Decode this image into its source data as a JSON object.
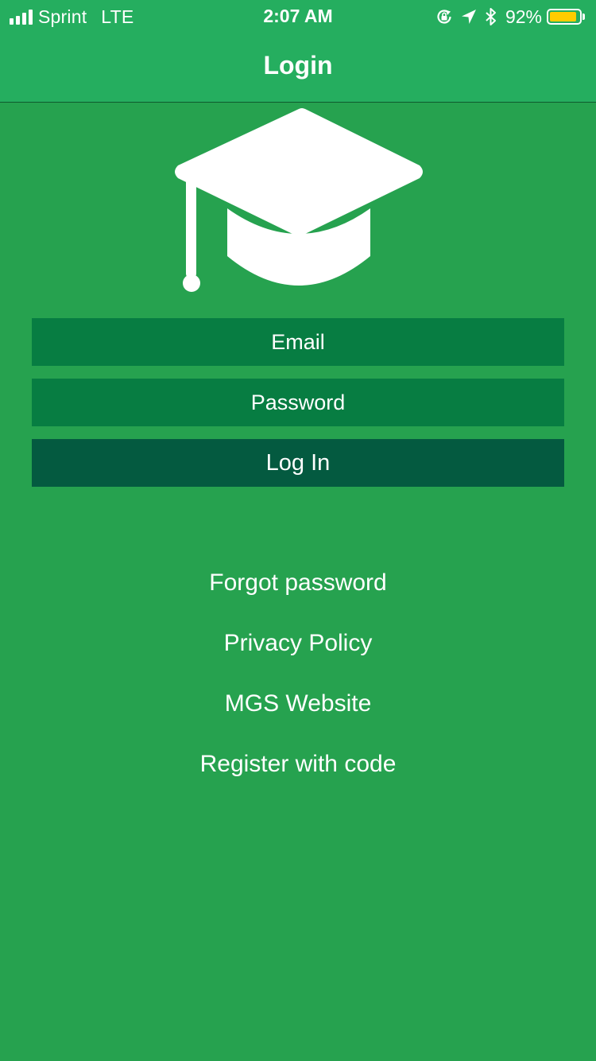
{
  "status_bar": {
    "carrier": "Sprint",
    "network": "LTE",
    "time": "2:07 AM",
    "battery_percent": "92%",
    "battery_level": 0.92,
    "battery_color": "#FFCC00",
    "icons": [
      "signal-icon",
      "orientation-lock-icon",
      "location-arrow-icon",
      "bluetooth-icon",
      "battery-icon"
    ]
  },
  "nav": {
    "title": "Login"
  },
  "logo": {
    "icon": "graduation-cap-icon"
  },
  "form": {
    "email_placeholder": "Email",
    "password_placeholder": "Password",
    "login_label": "Log In"
  },
  "links": {
    "forgot_password": "Forgot password",
    "privacy_policy": "Privacy Policy",
    "website": "MGS Website",
    "register": "Register with code"
  },
  "colors": {
    "background": "#26A24F",
    "nav_bar": "#25AE5F",
    "field": "#077D42",
    "button": "#045A40"
  }
}
